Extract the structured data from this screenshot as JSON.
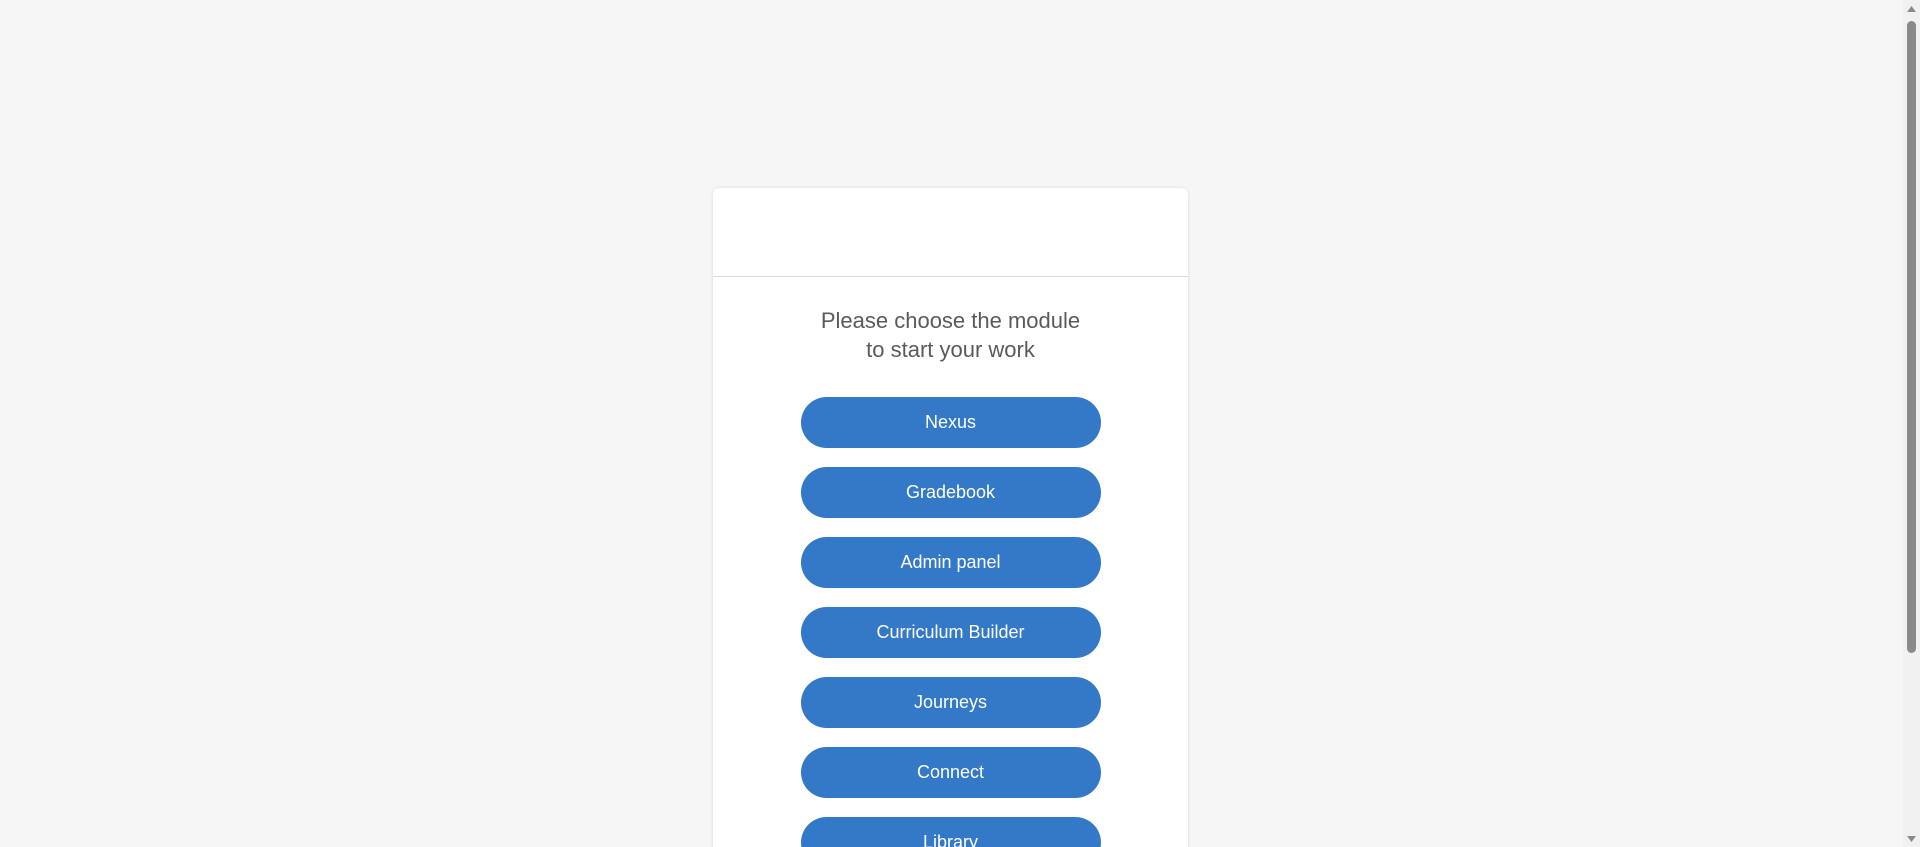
{
  "prompt": {
    "line1": "Please choose the module",
    "line2": "to start your work"
  },
  "modules": [
    {
      "label": "Nexus"
    },
    {
      "label": "Gradebook"
    },
    {
      "label": "Admin panel"
    },
    {
      "label": "Curriculum Builder"
    },
    {
      "label": "Journeys"
    },
    {
      "label": "Connect"
    },
    {
      "label": "Library"
    }
  ],
  "colors": {
    "background": "#f6f6f6",
    "card": "#ffffff",
    "button": "#3478c8",
    "button_text": "#ffffff",
    "prompt_text": "#5a5a5a"
  },
  "icons": {
    "scroll_up": "scroll-up-arrow-icon",
    "scroll_down": "scroll-down-arrow-icon"
  }
}
